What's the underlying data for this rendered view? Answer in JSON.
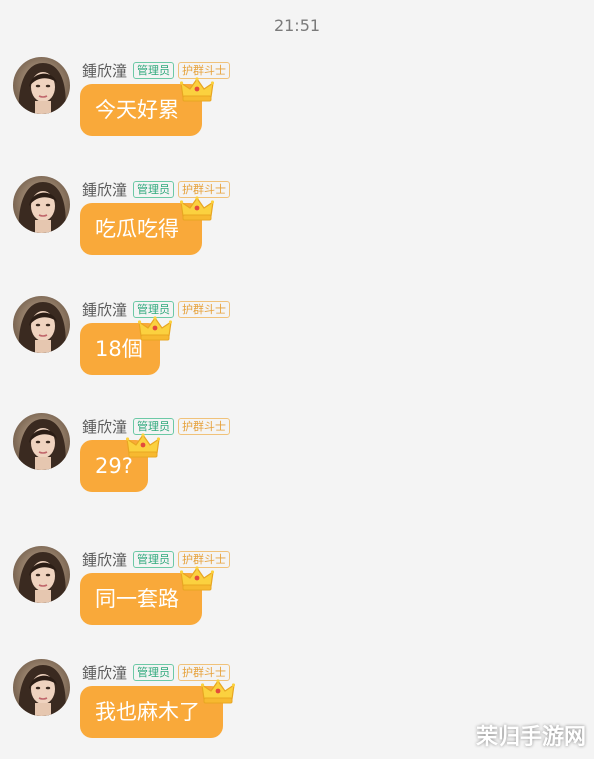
{
  "status_time": "21:51",
  "sender": {
    "name": "鍾欣潼",
    "badge_admin": "管理员",
    "badge_title": "护群斗士"
  },
  "messages": [
    {
      "text": "今天好累"
    },
    {
      "text": "吃瓜吃得"
    },
    {
      "text": "18個"
    },
    {
      "text": "29?"
    },
    {
      "text": "同一套路"
    },
    {
      "text": "我也麻木了"
    }
  ],
  "watermark": "茉归手游网",
  "colors": {
    "bubble": "#f9a93a",
    "background": "#f4f4f4",
    "badge_admin": "#2fa97c",
    "badge_title": "#e6a13a"
  },
  "icons": {
    "avatar": "avatar-photo",
    "bubble_decoration": "crown-icon"
  }
}
